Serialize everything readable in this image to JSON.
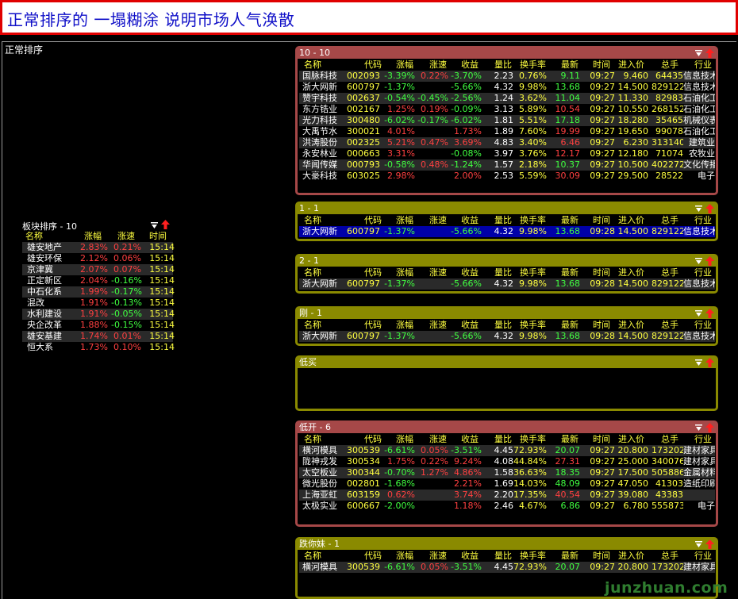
{
  "header": {
    "title": "正常排序的 一塌糊涂 说明市场人气涣散"
  },
  "main": {
    "title": "正常排序"
  },
  "colors": {
    "up": "#ff4040",
    "down": "#40ff40",
    "neutral": "#ffffff",
    "name": "#ffffff",
    "code": "#ffff40",
    "time": "#ffff40",
    "header": "#ffff40",
    "volume": "#ffff40"
  },
  "sector": {
    "title": "板块排序 - 10",
    "columns": {
      "name": "名称",
      "chg": "涨幅",
      "spd": "涨速",
      "time": "时间"
    },
    "rows": [
      {
        "name": "雄安地产",
        "chg": "2.83%",
        "spd": "0.21%",
        "time": "15:14"
      },
      {
        "name": "雄安环保",
        "chg": "2.12%",
        "spd": "0.06%",
        "time": "15:14"
      },
      {
        "name": "京津冀",
        "chg": "2.07%",
        "spd": "0.07%",
        "time": "15:14"
      },
      {
        "name": "正定新区",
        "chg": "2.04%",
        "spd": "-0.16%",
        "time": "15:14"
      },
      {
        "name": "中石化系",
        "chg": "1.99%",
        "spd": "-0.17%",
        "time": "15:14"
      },
      {
        "name": "混改",
        "chg": "1.91%",
        "spd": "-0.13%",
        "time": "15:14"
      },
      {
        "name": "水利建设",
        "chg": "1.91%",
        "spd": "-0.05%",
        "time": "15:14"
      },
      {
        "name": "央企改革",
        "chg": "1.88%",
        "spd": "-0.15%",
        "time": "15:14"
      },
      {
        "name": "雄安基建",
        "chg": "1.74%",
        "spd": "0.01%",
        "time": "15:14"
      },
      {
        "name": "恒大系",
        "chg": "1.73%",
        "spd": "0.10%",
        "time": "15:14"
      }
    ]
  },
  "columns": {
    "name": "名称",
    "code": "代码",
    "chg": "涨幅",
    "spd": "涨速",
    "ret": "收益",
    "vr": "量比",
    "to": "换手率",
    "last": "最新",
    "time": "时间",
    "entry": "进入价",
    "vol": "总手",
    "ind": "行业"
  },
  "panels": [
    {
      "title": "10 - 10",
      "style": "red",
      "rows": [
        {
          "name": "国脉科技",
          "code": "002093",
          "chg": "-3.39%",
          "spd": "0.22%",
          "ret": "-3.70%",
          "vr": "2.23",
          "to": "0.76%",
          "last": "9.11",
          "time": "09:27",
          "entry": "9.460",
          "vol": "64435",
          "ind": "信息技术"
        },
        {
          "name": "浙大网新",
          "code": "600797",
          "chg": "-1.37%",
          "spd": "",
          "ret": "-5.66%",
          "vr": "4.32",
          "to": "9.98%",
          "last": "13.68",
          "time": "09:27",
          "entry": "14.500",
          "vol": "829122",
          "ind": "信息技术"
        },
        {
          "name": "赞宇科技",
          "code": "002637",
          "chg": "-0.54%",
          "spd": "-0.45%",
          "ret": "-2.56%",
          "vr": "1.24",
          "to": "3.62%",
          "last": "11.04",
          "time": "09:27",
          "entry": "11.330",
          "vol": "82983",
          "ind": "石油化工"
        },
        {
          "name": "东方锆业",
          "code": "002167",
          "chg": "1.25%",
          "spd": "0.19%",
          "ret": "-0.09%",
          "vr": "3.13",
          "to": "5.89%",
          "last": "10.54",
          "time": "09:27",
          "entry": "10.550",
          "vol": "268152",
          "ind": "石油化工"
        },
        {
          "name": "光力科技",
          "code": "300480",
          "chg": "-6.02%",
          "spd": "-0.17%",
          "ret": "-6.02%",
          "vr": "1.81",
          "to": "5.51%",
          "last": "17.18",
          "time": "09:27",
          "entry": "18.280",
          "vol": "35465",
          "ind": "机械仪表"
        },
        {
          "name": "大禹节水",
          "code": "300021",
          "chg": "4.01%",
          "spd": "",
          "ret": "1.73%",
          "vr": "1.89",
          "to": "7.60%",
          "last": "19.99",
          "time": "09:27",
          "entry": "19.650",
          "vol": "99078",
          "ind": "石油化工"
        },
        {
          "name": "洪涛股份",
          "code": "002325",
          "chg": "5.21%",
          "spd": "0.47%",
          "ret": "3.69%",
          "vr": "4.83",
          "to": "3.40%",
          "last": "6.46",
          "time": "09:27",
          "entry": "6.230",
          "vol": "313140",
          "ind": "建筑业"
        },
        {
          "name": "永安林业",
          "code": "000663",
          "chg": "3.31%",
          "spd": "",
          "ret": "-0.08%",
          "vr": "3.97",
          "to": "3.76%",
          "last": "12.17",
          "time": "09:27",
          "entry": "12.180",
          "vol": "71074",
          "ind": "农牧业"
        },
        {
          "name": "华闻传媒",
          "code": "000793",
          "chg": "-0.58%",
          "spd": "0.48%",
          "ret": "-1.24%",
          "vr": "1.57",
          "to": "2.18%",
          "last": "10.37",
          "time": "09:27",
          "entry": "10.500",
          "vol": "402272",
          "ind": "文化传播"
        },
        {
          "name": "大豪科技",
          "code": "603025",
          "chg": "2.98%",
          "spd": "",
          "ret": "2.00%",
          "vr": "2.53",
          "to": "5.59%",
          "last": "30.09",
          "time": "09:27",
          "entry": "29.500",
          "vol": "28522",
          "ind": "电子"
        }
      ]
    },
    {
      "title": "1 - 1",
      "style": "olive",
      "rows": [
        {
          "name": "浙大网新",
          "code": "600797",
          "chg": "-1.37%",
          "spd": "",
          "ret": "-5.66%",
          "vr": "4.32",
          "to": "9.98%",
          "last": "13.68",
          "time": "09:28",
          "entry": "14.500",
          "vol": "829122",
          "ind": "信息技术"
        }
      ]
    },
    {
      "title": "2 - 1",
      "style": "olive",
      "rows": [
        {
          "name": "浙大网新",
          "code": "600797",
          "chg": "-1.37%",
          "spd": "",
          "ret": "-5.66%",
          "vr": "4.32",
          "to": "9.98%",
          "last": "13.68",
          "time": "09:28",
          "entry": "14.500",
          "vol": "829122",
          "ind": "信息技术"
        }
      ]
    },
    {
      "title": "刚 - 1",
      "style": "olive",
      "rows": [
        {
          "name": "浙大网新",
          "code": "600797",
          "chg": "-1.37%",
          "spd": "",
          "ret": "-5.66%",
          "vr": "4.32",
          "to": "9.98%",
          "last": "13.68",
          "time": "09:28",
          "entry": "14.500",
          "vol": "829122",
          "ind": "信息技术"
        }
      ]
    },
    {
      "title": "低买",
      "style": "olive",
      "rows": []
    },
    {
      "title": "低开 - 6",
      "style": "red",
      "rows": [
        {
          "name": "横河模具",
          "code": "300539",
          "chg": "-6.61%",
          "spd": "0.05%",
          "ret": "-3.51%",
          "vr": "4.45",
          "to": "72.93%",
          "last": "20.07",
          "time": "09:27",
          "entry": "20.800",
          "vol": "173202",
          "ind": "建材家具"
        },
        {
          "name": "陇神戎发",
          "code": "300534",
          "chg": "1.75%",
          "spd": "0.22%",
          "ret": "9.24%",
          "vr": "4.08",
          "to": "44.84%",
          "last": "27.31",
          "time": "09:27",
          "entry": "25.000",
          "vol": "340076",
          "ind": "建材家具"
        },
        {
          "name": "太空板业",
          "code": "300344",
          "chg": "-0.70%",
          "spd": "1.27%",
          "ret": "4.86%",
          "vr": "1.58",
          "to": "36.63%",
          "last": "18.35",
          "time": "09:27",
          "entry": "17.500",
          "vol": "505886",
          "ind": "金属材料"
        },
        {
          "name": "微光股份",
          "code": "002801",
          "chg": "-1.68%",
          "spd": "",
          "ret": "2.21%",
          "vr": "1.69",
          "to": "14.03%",
          "last": "48.09",
          "time": "09:27",
          "entry": "47.050",
          "vol": "41303",
          "ind": "造纸印刷"
        },
        {
          "name": "上海亚虹",
          "code": "603159",
          "chg": "0.62%",
          "spd": "",
          "ret": "3.74%",
          "vr": "2.20",
          "to": "17.35%",
          "last": "40.54",
          "time": "09:27",
          "entry": "39.080",
          "vol": "43383",
          "ind": ""
        },
        {
          "name": "太极实业",
          "code": "600667",
          "chg": "-2.00%",
          "spd": "",
          "ret": "1.18%",
          "vr": "2.46",
          "to": "4.67%",
          "last": "6.86",
          "time": "09:27",
          "entry": "6.780",
          "vol": "555873",
          "ind": "电子"
        }
      ]
    },
    {
      "title": "跌你妹 - 1",
      "style": "olive",
      "rows": [
        {
          "name": "横河模具",
          "code": "300539",
          "chg": "-6.61%",
          "spd": "0.05%",
          "ret": "-3.51%",
          "vr": "4.45",
          "to": "72.93%",
          "last": "20.07",
          "time": "09:27",
          "entry": "20.800",
          "vol": "173202",
          "ind": "建材家具"
        }
      ]
    }
  ],
  "watermark": "junzhuan.com"
}
